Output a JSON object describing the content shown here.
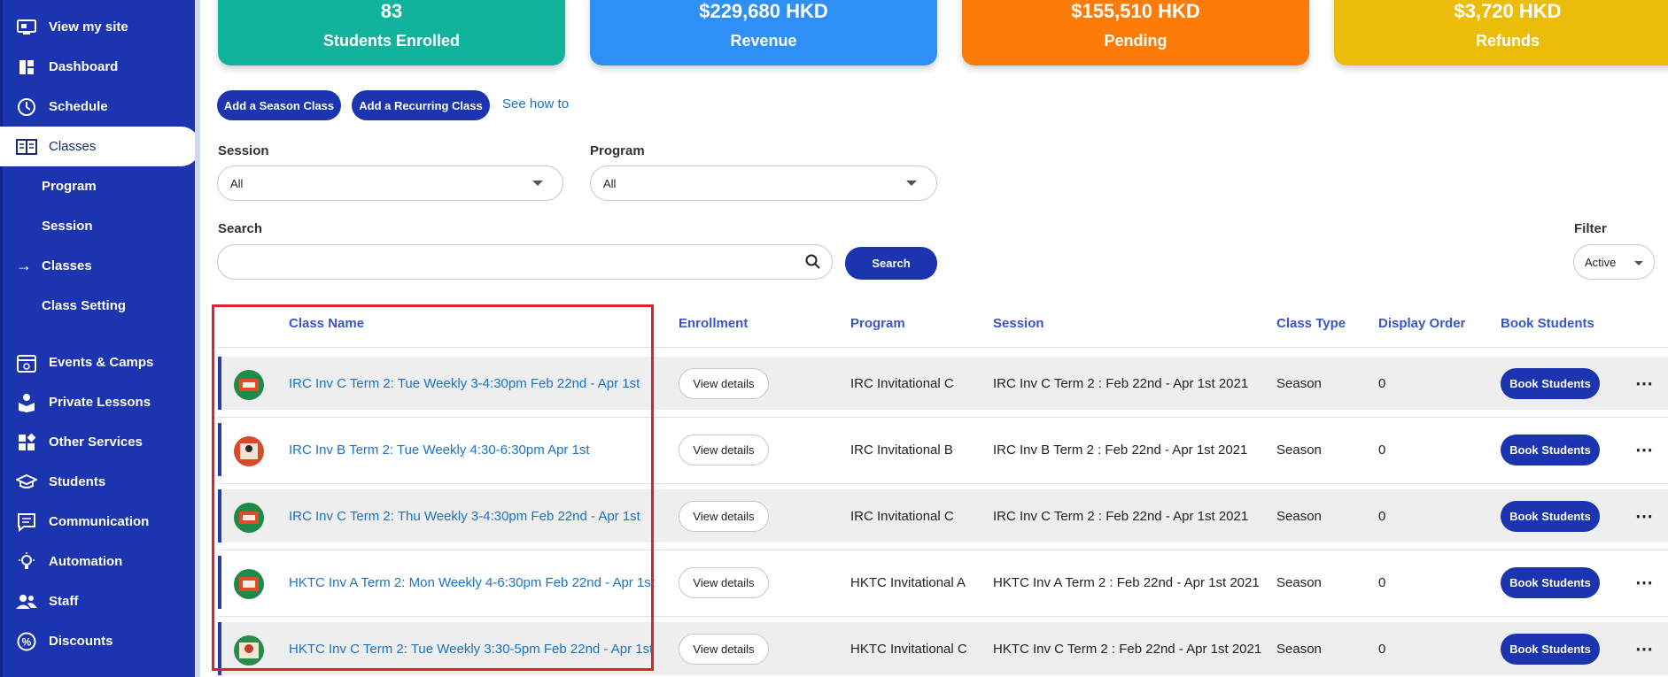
{
  "sidebar": {
    "items": [
      {
        "label": "View my site",
        "icon": "monitor-icon"
      },
      {
        "label": "Dashboard",
        "icon": "dashboard-icon"
      },
      {
        "label": "Schedule",
        "icon": "clock-icon"
      },
      {
        "label": "Classes",
        "icon": "book-icon"
      },
      {
        "label": "Program"
      },
      {
        "label": "Session"
      },
      {
        "label": "Classes",
        "icon": "arrow-right-icon"
      },
      {
        "label": "Class Setting"
      },
      {
        "label": "Events & Camps",
        "icon": "calendar-icon"
      },
      {
        "label": "Private Lessons",
        "icon": "private-lesson-icon"
      },
      {
        "label": "Other Services",
        "icon": "services-icon"
      },
      {
        "label": "Students",
        "icon": "graduation-cap-icon"
      },
      {
        "label": "Communication",
        "icon": "chat-icon"
      },
      {
        "label": "Automation",
        "icon": "bulb-icon"
      },
      {
        "label": "Staff",
        "icon": "staff-icon"
      },
      {
        "label": "Discounts",
        "icon": "percent-icon"
      }
    ]
  },
  "stats": [
    {
      "value": "83",
      "label": "Students Enrolled",
      "color": "#12b39d"
    },
    {
      "value": "$229,680 HKD",
      "label": "Revenue",
      "color": "#2e8ff5"
    },
    {
      "value": "$155,510 HKD",
      "label": "Pending",
      "color": "#fb7c08"
    },
    {
      "value": "$3,720 HKD",
      "label": "Refunds",
      "color": "#ecbc0a"
    }
  ],
  "actions": {
    "add_season": "Add a Season Class",
    "add_recurring": "Add a Recurring Class",
    "see_how": "See how to"
  },
  "filters": {
    "session_label": "Session",
    "session_value": "All",
    "program_label": "Program",
    "program_value": "All",
    "search_label": "Search",
    "search_value": "",
    "search_button": "Search",
    "filter_label": "Filter",
    "filter_value": "Active"
  },
  "table": {
    "headers": {
      "class_name": "Class Name",
      "enrollment": "Enrollment",
      "program": "Program",
      "session": "Session",
      "class_type": "Class Type",
      "display_order": "Display Order",
      "book_students": "Book Students"
    },
    "view_details": "View details",
    "book_label": "Book Students",
    "rows": [
      {
        "name": "IRC Inv C Term 2: Tue Weekly 3-4:30pm Feb 22nd - Apr 1st",
        "program": "IRC Invitational C",
        "session": "IRC Inv C Term 2 : Feb 22nd - Apr 1st 2021",
        "type": "Season",
        "order": "0"
      },
      {
        "name": "IRC Inv B Term 2: Tue Weekly 4:30-6:30pm Apr 1st",
        "program": "IRC Invitational B",
        "session": "IRC Inv B Term 2 : Feb 22nd - Apr 1st 2021",
        "type": "Season",
        "order": "0"
      },
      {
        "name": "IRC Inv C Term 2: Thu Weekly 3-4:30pm Feb 22nd - Apr 1st",
        "program": "IRC Invitational C",
        "session": "IRC Inv C Term 2 : Feb 22nd - Apr 1st 2021",
        "type": "Season",
        "order": "0"
      },
      {
        "name": "HKTC Inv A Term 2: Mon Weekly 4-6:30pm Feb 22nd - Apr 1st",
        "program": "HKTC Invitational A",
        "session": "HKTC Inv A Term 2 : Feb 22nd - Apr 1st 2021",
        "type": "Season",
        "order": "0"
      },
      {
        "name": "HKTC Inv C Term 2: Tue Weekly 3:30-5pm Feb 22nd - Apr 1st",
        "program": "HKTC Invitational C",
        "session": "HKTC Inv C Term 2 : Feb 22nd - Apr 1st 2021",
        "type": "Season",
        "order": "0"
      }
    ]
  }
}
